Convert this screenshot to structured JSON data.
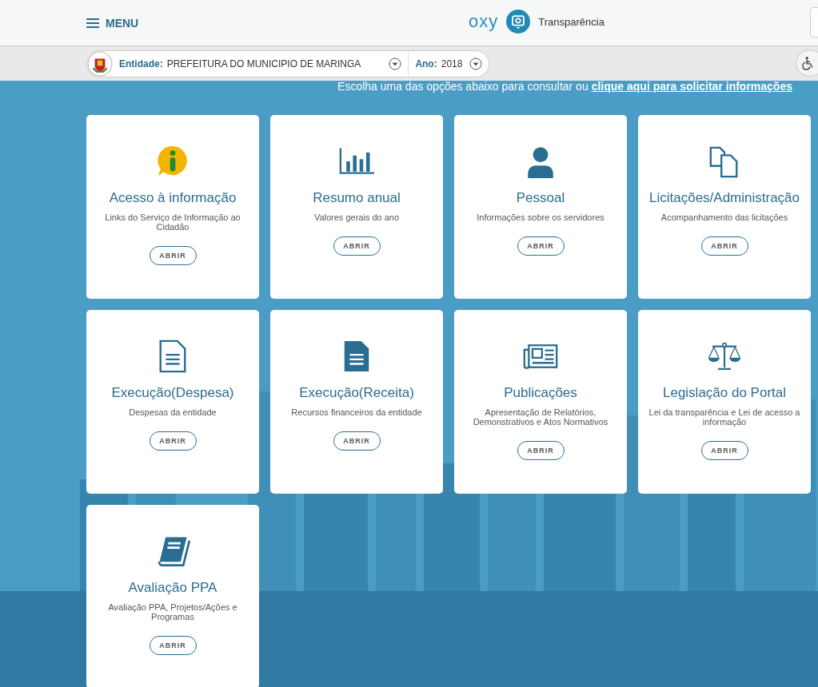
{
  "header": {
    "menu_label": "MENU",
    "logo_text": "oxy",
    "brand": "Transparência"
  },
  "toolbar": {
    "entity_label": "Entidade:",
    "entity_value": "PREFEITURA DO MUNICIPIO DE MARINGA",
    "year_label": "Ano:",
    "year_value": "2018"
  },
  "intro": {
    "text": "Escolha uma das opções abaixo para consultar ou",
    "link": "clique aqui para solicitar informações"
  },
  "cards": [
    {
      "title": "Acesso à informação",
      "description": "Links do Serviço de Informação ao Cidadão",
      "button": "ABRIR"
    },
    {
      "title": "Resumo anual",
      "description": "Valores gerais do ano",
      "button": "ABRIR"
    },
    {
      "title": "Pessoal",
      "description": "Informações sobre os servidores",
      "button": "ABRIR"
    },
    {
      "title": "Licitações/Administração",
      "description": "Acompanhamento das licitações",
      "button": "ABRIR"
    },
    {
      "title": "Execução(Despesa)",
      "description": "Despesas da entidade",
      "button": "ABRIR"
    },
    {
      "title": "Execução(Receita)",
      "description": "Recursos financeiros da entidade",
      "button": "ABRIR"
    },
    {
      "title": "Publicações",
      "description": "Apresentação de Relatórios, Demonstrativos e Atos Normativos",
      "button": "ABRIR"
    },
    {
      "title": "Legislação do Portal",
      "description": "Lei da transparência e Lei de acesso a informação",
      "button": "ABRIR"
    },
    {
      "title": "Avaliação PPA",
      "description": "Avaliação PPA, Projetos/Ações e Programas",
      "button": "ABRIR"
    }
  ]
}
